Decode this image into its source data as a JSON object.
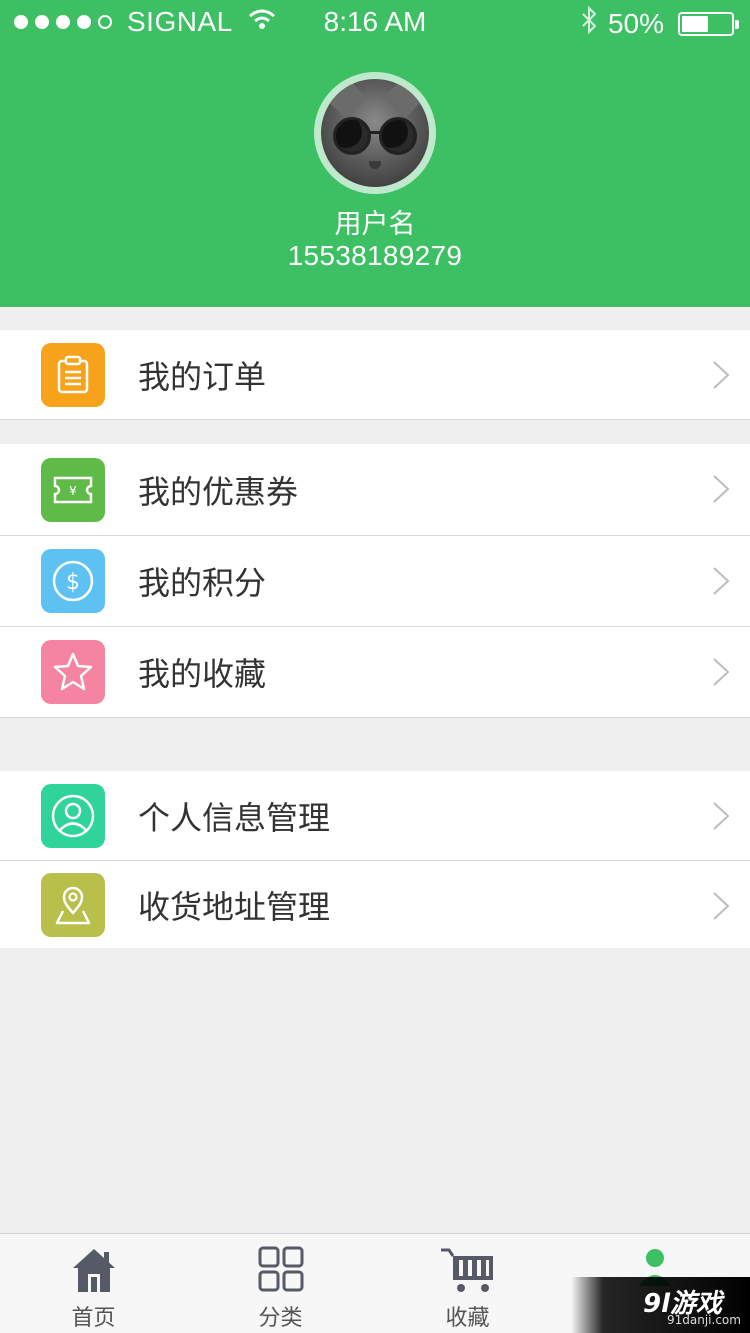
{
  "status_bar": {
    "carrier": "SIGNAL",
    "time": "8:16 AM",
    "battery": "50%",
    "battery_level": 0.5,
    "signal_bars_filled": 4
  },
  "profile": {
    "username": "用户名",
    "phone": "15538189279"
  },
  "menu_groups": [
    [
      {
        "label": "我的订单",
        "icon": "clipboard-icon",
        "color": "#f7a21b"
      }
    ],
    [
      {
        "label": "我的优惠券",
        "icon": "coupon-icon",
        "color": "#5fba47"
      },
      {
        "label": "我的积分",
        "icon": "dollar-coin-icon",
        "color": "#5dc1f2"
      },
      {
        "label": "我的收藏",
        "icon": "star-icon",
        "color": "#f584a0"
      }
    ],
    [
      {
        "label": "个人信息管理",
        "icon": "user-circle-icon",
        "color": "#2fd49a"
      },
      {
        "label": "收货地址管理",
        "icon": "map-pin-icon",
        "color": "#b9bf4b"
      }
    ]
  ],
  "tabs": [
    {
      "label": "首页",
      "icon": "home-icon"
    },
    {
      "label": "分类",
      "icon": "grid-icon"
    },
    {
      "label": "收藏",
      "icon": "cart-icon"
    },
    {
      "label": "",
      "icon": "user-icon",
      "active": true
    }
  ],
  "colors": {
    "brand_green": "#3cc063",
    "background": "#efefef",
    "tab_icon": "#555a66"
  },
  "watermark": {
    "main": "9l游戏",
    "sub": "91danji.com"
  }
}
